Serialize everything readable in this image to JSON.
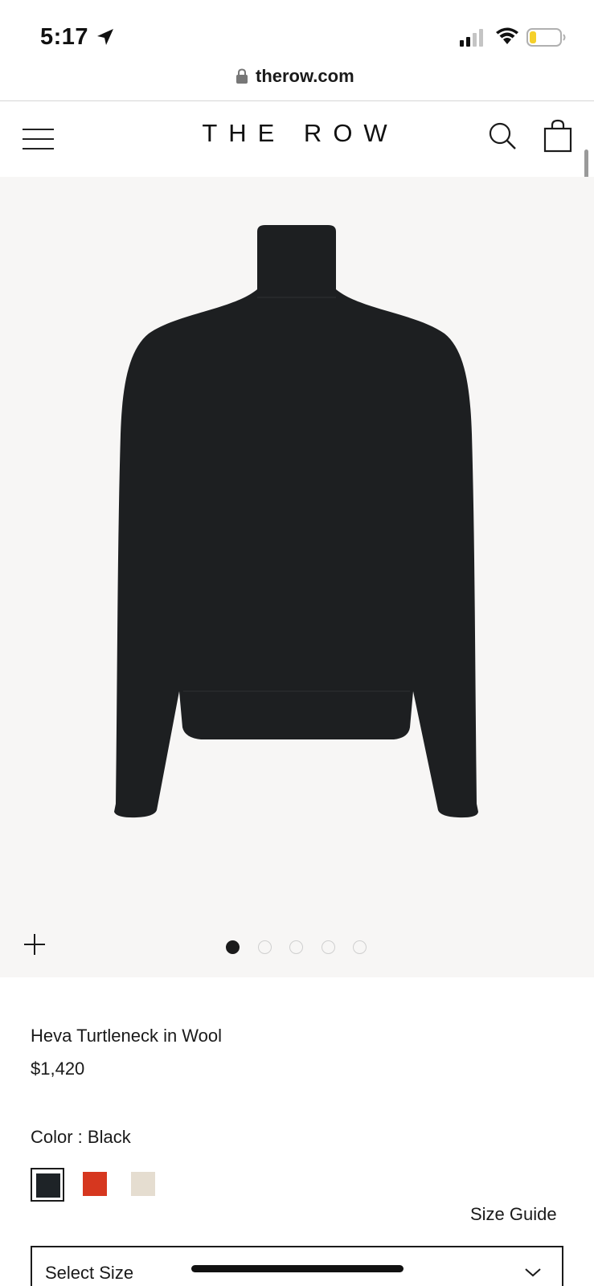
{
  "status_bar": {
    "time": "5:17",
    "icons": [
      "location-arrow-icon",
      "signal-icon",
      "wifi-icon",
      "battery-icon"
    ],
    "battery_color": "#f5d02b"
  },
  "browser": {
    "url": "therow.com",
    "icon": "lock-icon"
  },
  "header": {
    "brand": "THE ROW",
    "icons": [
      "menu-icon",
      "search-icon",
      "shopping-bag-icon"
    ]
  },
  "gallery": {
    "image": "black-turtleneck-sweater",
    "slide_count": 5,
    "active_slide": 1,
    "icons": [
      "zoom-plus-icon"
    ],
    "background": "#f7f6f5"
  },
  "product": {
    "name": "Heva Turtleneck in Wool",
    "price": "$1,420",
    "color_label": "Color : Black",
    "swatches": [
      {
        "name": "Black",
        "hex": "#1e2327",
        "selected": true
      },
      {
        "name": "Red",
        "hex": "#d6371f",
        "selected": false
      },
      {
        "name": "Ivory",
        "hex": "#e5ddd0",
        "selected": false
      }
    ],
    "size_guide": "Size Guide",
    "size_select": "Select Size"
  }
}
